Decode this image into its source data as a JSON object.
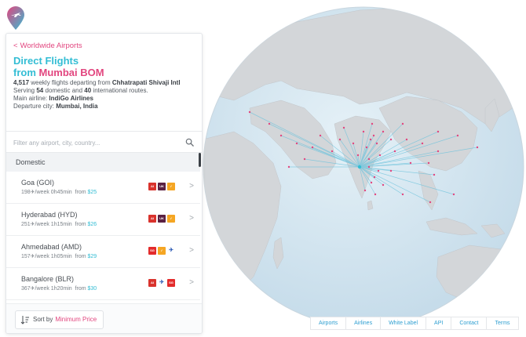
{
  "back_link": "Worldwide Airports",
  "heading": {
    "line1": "Direct Flights",
    "from": "from ",
    "city": "Mumbai BOM"
  },
  "info": {
    "flights_count": "4,517",
    "flights_text": " weekly flights departing from ",
    "airport_name": "Chhatrapati Shivaji Intl",
    "serving_prefix": "Serving ",
    "domestic_count": "54",
    "serving_mid": " domestic and ",
    "international_count": "40",
    "serving_suffix": " international routes.",
    "main_airline_label": "Main airline: ",
    "main_airline": "IndiGo Airlines",
    "departure_label": "Departure city: ",
    "departure_city": "Mumbai, India"
  },
  "filter": {
    "placeholder": "Filter any airport, city, country..."
  },
  "section": "Domestic",
  "routes": [
    {
      "name": "Goa (GOI)",
      "freq": "198✈/week",
      "duration": "0h45min",
      "from_label": "from ",
      "price": "$25",
      "airlines": [
        "air-india",
        "vistara",
        "indigo"
      ]
    },
    {
      "name": "Hyderabad (HYD)",
      "freq": "251✈/week",
      "duration": "1h15min",
      "from_label": "from ",
      "price": "$26",
      "airlines": [
        "air-india",
        "vistara",
        "indigo"
      ]
    },
    {
      "name": "Ahmedabad (AMD)",
      "freq": "157✈/week",
      "duration": "1h05min",
      "from_label": "from ",
      "price": "$29",
      "airlines": [
        "spicejet",
        "indigo",
        "goair"
      ]
    },
    {
      "name": "Bangalore (BLR)",
      "freq": "367✈/week",
      "duration": "1h20min",
      "from_label": "from ",
      "price": "$30",
      "airlines": [
        "air-india",
        "goair",
        "spicejet"
      ]
    }
  ],
  "sort": {
    "label": "Sort by",
    "value": "Minimum Price"
  },
  "footer": [
    "Airports",
    "Airlines",
    "White Label",
    "API",
    "Contact",
    "Terms"
  ],
  "colors": {
    "accent_pink": "#e2467f",
    "accent_teal": "#33bdd4",
    "ocean": "#cde3ef",
    "land": "#d4d7da"
  }
}
